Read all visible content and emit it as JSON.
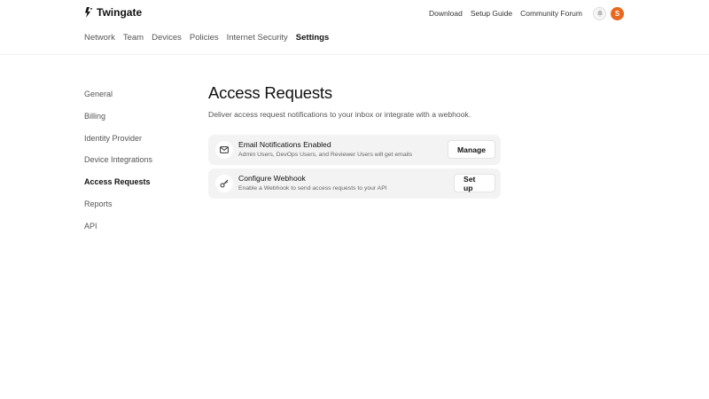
{
  "brand": {
    "name": "Twingate"
  },
  "utility_nav": {
    "download": "Download",
    "setup_guide": "Setup Guide",
    "community_forum": "Community Forum",
    "avatar_initial": "S",
    "avatar_color": "#e8681f"
  },
  "main_nav": {
    "items": [
      "Network",
      "Team",
      "Devices",
      "Policies",
      "Internet Security",
      "Settings"
    ],
    "active": "Settings"
  },
  "sidebar": {
    "items": [
      "General",
      "Billing",
      "Identity Provider",
      "Device Integrations",
      "Access Requests",
      "Reports",
      "API"
    ],
    "active": "Access Requests"
  },
  "page": {
    "title": "Access Requests",
    "subtitle": "Deliver access request notifications to your inbox or integrate with a webhook."
  },
  "cards": [
    {
      "icon": "mail-icon",
      "heading": "Email Notifications Enabled",
      "description": "Admin Users, DevOps Users, and Reviewer Users will get emails",
      "button": "Manage"
    },
    {
      "icon": "key-icon",
      "heading": "Configure Webhook",
      "description": "Enable a Webhook to send access requests to your API",
      "button": "Set up"
    }
  ]
}
